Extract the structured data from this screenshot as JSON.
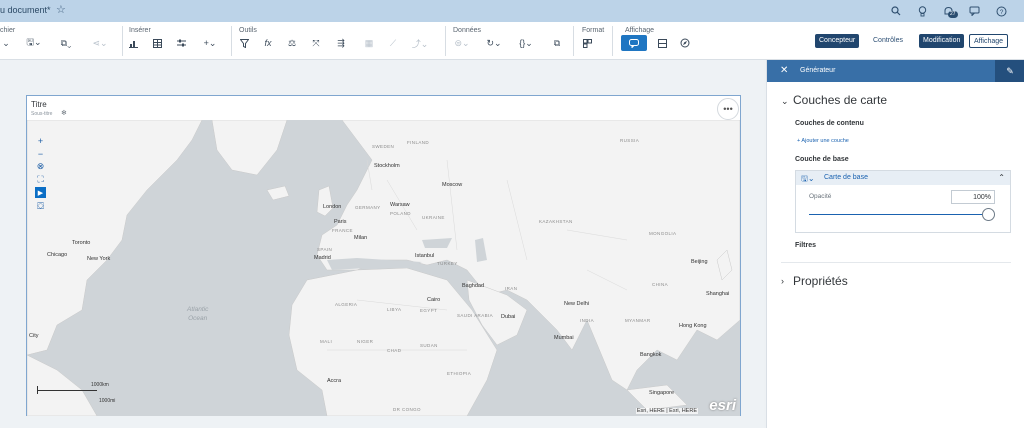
{
  "shell": {
    "doc_title": "u document*"
  },
  "toolbar": {
    "groups": {
      "file": "chier",
      "insert": "Insérer",
      "tools": "Outils",
      "data": "Données",
      "format": "Format",
      "display": "Affichage"
    },
    "modes": {
      "designer": "Concepteur",
      "controls": "Contrôles",
      "edit": "Modification",
      "view": "Affichage"
    }
  },
  "widget": {
    "title": "Titre",
    "subtitle": "Sous-titre",
    "more": "•••"
  },
  "map": {
    "cities": {
      "stockholm": "Stockholm",
      "moscow": "Moscow",
      "london": "London",
      "warsaw": "Warsaw",
      "paris": "Paris",
      "milan": "Milan",
      "madrid": "Madrid",
      "istanbul": "Istanbul",
      "toronto": "Toronto",
      "chicago": "Chicago",
      "new_york": "New York",
      "baghdad": "Baghdad",
      "cairo": "Cairo",
      "dubai": "Dubai",
      "new_delhi": "New Delhi",
      "mumbai": "Mumbai",
      "beijing": "Beijing",
      "shanghai": "Shanghai",
      "hong_kong": "Hong Kong",
      "bangkok": "Bangkok",
      "singapore": "Singapore",
      "accra": "Accra",
      "city": "City"
    },
    "countries": {
      "sweden": "SWEDEN",
      "finland": "FINLAND",
      "russia": "RUSSIA",
      "germany": "GERMANY",
      "poland": "POLAND",
      "ukraine": "UKRAINE",
      "france": "FRANCE",
      "spain": "SPAIN",
      "turkey": "TURKEY",
      "kazakhstan": "KAZAKHSTAN",
      "mongolia": "MONGOLIA",
      "algeria": "ALGERIA",
      "libya": "LIBYA",
      "egypt": "EGYPT",
      "iran": "IRAN",
      "saudi_arabia": "SAUDI ARABIA",
      "india": "INDIA",
      "china": "CHINA",
      "myanmar": "MYANMAR",
      "mali": "MALI",
      "niger": "NIGER",
      "chad": "CHAD",
      "sudan": "SUDAN",
      "ethiopia": "ETHIOPIA",
      "dr_congo": "DR CONGO"
    },
    "ocean_atlantic": "Atlantic\nOcean",
    "scale_top": "1000km",
    "scale_bottom": "1000mi",
    "attribution": "Esri, HERE | Esri, HERE",
    "esri_logo": "esri"
  },
  "panel": {
    "header": "Générateur",
    "layers_title": "Couches de carte",
    "content_layers": "Couches de contenu",
    "add_layer": "+ Ajouter une couche",
    "base_layer": "Couche de base",
    "basemap_name": "Carte de base",
    "opacity_label": "Opacité",
    "opacity_value": "100%",
    "filters": "Filtres",
    "properties": "Propriétés"
  }
}
